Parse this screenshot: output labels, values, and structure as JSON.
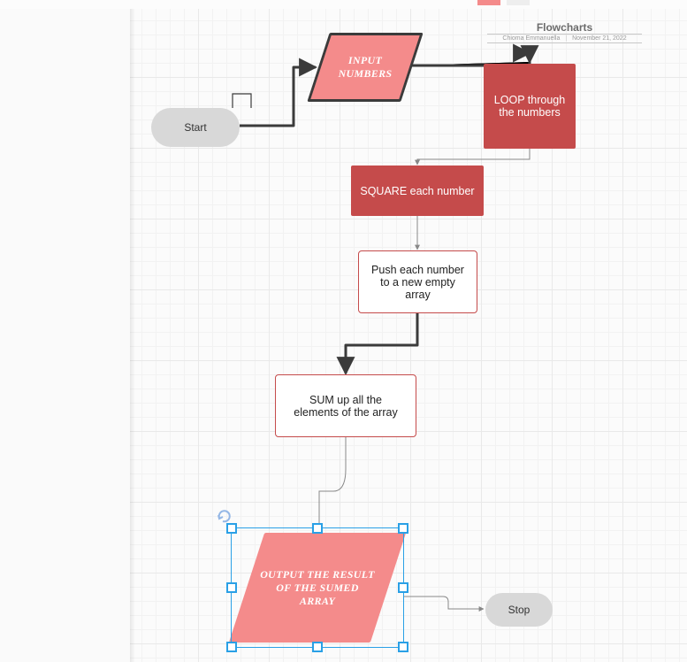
{
  "doc": {
    "title": "Flowcharts",
    "author": "Chioma Emmanuella",
    "date": "November 21, 2022"
  },
  "nodes": {
    "start": "Start",
    "input": "INPUT NUMBERS",
    "loop": "LOOP through the numbers",
    "square": "SQUARE each number",
    "push": "Push each number to a new empty array",
    "sum": "SUM up all the elements of the array",
    "output": "OUTPUT  THE RESULT OF THE SUMED ARRAY",
    "stop": "Stop"
  }
}
